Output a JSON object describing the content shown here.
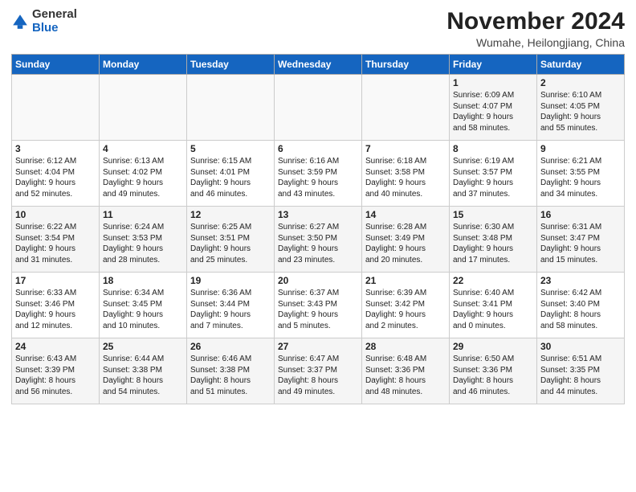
{
  "header": {
    "logo_general": "General",
    "logo_blue": "Blue",
    "month": "November 2024",
    "location": "Wumahe, Heilongjiang, China"
  },
  "weekdays": [
    "Sunday",
    "Monday",
    "Tuesday",
    "Wednesday",
    "Thursday",
    "Friday",
    "Saturday"
  ],
  "weeks": [
    [
      {
        "day": "",
        "detail": ""
      },
      {
        "day": "",
        "detail": ""
      },
      {
        "day": "",
        "detail": ""
      },
      {
        "day": "",
        "detail": ""
      },
      {
        "day": "",
        "detail": ""
      },
      {
        "day": "1",
        "detail": "Sunrise: 6:09 AM\nSunset: 4:07 PM\nDaylight: 9 hours\nand 58 minutes."
      },
      {
        "day": "2",
        "detail": "Sunrise: 6:10 AM\nSunset: 4:05 PM\nDaylight: 9 hours\nand 55 minutes."
      }
    ],
    [
      {
        "day": "3",
        "detail": "Sunrise: 6:12 AM\nSunset: 4:04 PM\nDaylight: 9 hours\nand 52 minutes."
      },
      {
        "day": "4",
        "detail": "Sunrise: 6:13 AM\nSunset: 4:02 PM\nDaylight: 9 hours\nand 49 minutes."
      },
      {
        "day": "5",
        "detail": "Sunrise: 6:15 AM\nSunset: 4:01 PM\nDaylight: 9 hours\nand 46 minutes."
      },
      {
        "day": "6",
        "detail": "Sunrise: 6:16 AM\nSunset: 3:59 PM\nDaylight: 9 hours\nand 43 minutes."
      },
      {
        "day": "7",
        "detail": "Sunrise: 6:18 AM\nSunset: 3:58 PM\nDaylight: 9 hours\nand 40 minutes."
      },
      {
        "day": "8",
        "detail": "Sunrise: 6:19 AM\nSunset: 3:57 PM\nDaylight: 9 hours\nand 37 minutes."
      },
      {
        "day": "9",
        "detail": "Sunrise: 6:21 AM\nSunset: 3:55 PM\nDaylight: 9 hours\nand 34 minutes."
      }
    ],
    [
      {
        "day": "10",
        "detail": "Sunrise: 6:22 AM\nSunset: 3:54 PM\nDaylight: 9 hours\nand 31 minutes."
      },
      {
        "day": "11",
        "detail": "Sunrise: 6:24 AM\nSunset: 3:53 PM\nDaylight: 9 hours\nand 28 minutes."
      },
      {
        "day": "12",
        "detail": "Sunrise: 6:25 AM\nSunset: 3:51 PM\nDaylight: 9 hours\nand 25 minutes."
      },
      {
        "day": "13",
        "detail": "Sunrise: 6:27 AM\nSunset: 3:50 PM\nDaylight: 9 hours\nand 23 minutes."
      },
      {
        "day": "14",
        "detail": "Sunrise: 6:28 AM\nSunset: 3:49 PM\nDaylight: 9 hours\nand 20 minutes."
      },
      {
        "day": "15",
        "detail": "Sunrise: 6:30 AM\nSunset: 3:48 PM\nDaylight: 9 hours\nand 17 minutes."
      },
      {
        "day": "16",
        "detail": "Sunrise: 6:31 AM\nSunset: 3:47 PM\nDaylight: 9 hours\nand 15 minutes."
      }
    ],
    [
      {
        "day": "17",
        "detail": "Sunrise: 6:33 AM\nSunset: 3:46 PM\nDaylight: 9 hours\nand 12 minutes."
      },
      {
        "day": "18",
        "detail": "Sunrise: 6:34 AM\nSunset: 3:45 PM\nDaylight: 9 hours\nand 10 minutes."
      },
      {
        "day": "19",
        "detail": "Sunrise: 6:36 AM\nSunset: 3:44 PM\nDaylight: 9 hours\nand 7 minutes."
      },
      {
        "day": "20",
        "detail": "Sunrise: 6:37 AM\nSunset: 3:43 PM\nDaylight: 9 hours\nand 5 minutes."
      },
      {
        "day": "21",
        "detail": "Sunrise: 6:39 AM\nSunset: 3:42 PM\nDaylight: 9 hours\nand 2 minutes."
      },
      {
        "day": "22",
        "detail": "Sunrise: 6:40 AM\nSunset: 3:41 PM\nDaylight: 9 hours\nand 0 minutes."
      },
      {
        "day": "23",
        "detail": "Sunrise: 6:42 AM\nSunset: 3:40 PM\nDaylight: 8 hours\nand 58 minutes."
      }
    ],
    [
      {
        "day": "24",
        "detail": "Sunrise: 6:43 AM\nSunset: 3:39 PM\nDaylight: 8 hours\nand 56 minutes."
      },
      {
        "day": "25",
        "detail": "Sunrise: 6:44 AM\nSunset: 3:38 PM\nDaylight: 8 hours\nand 54 minutes."
      },
      {
        "day": "26",
        "detail": "Sunrise: 6:46 AM\nSunset: 3:38 PM\nDaylight: 8 hours\nand 51 minutes."
      },
      {
        "day": "27",
        "detail": "Sunrise: 6:47 AM\nSunset: 3:37 PM\nDaylight: 8 hours\nand 49 minutes."
      },
      {
        "day": "28",
        "detail": "Sunrise: 6:48 AM\nSunset: 3:36 PM\nDaylight: 8 hours\nand 48 minutes."
      },
      {
        "day": "29",
        "detail": "Sunrise: 6:50 AM\nSunset: 3:36 PM\nDaylight: 8 hours\nand 46 minutes."
      },
      {
        "day": "30",
        "detail": "Sunrise: 6:51 AM\nSunset: 3:35 PM\nDaylight: 8 hours\nand 44 minutes."
      }
    ]
  ]
}
